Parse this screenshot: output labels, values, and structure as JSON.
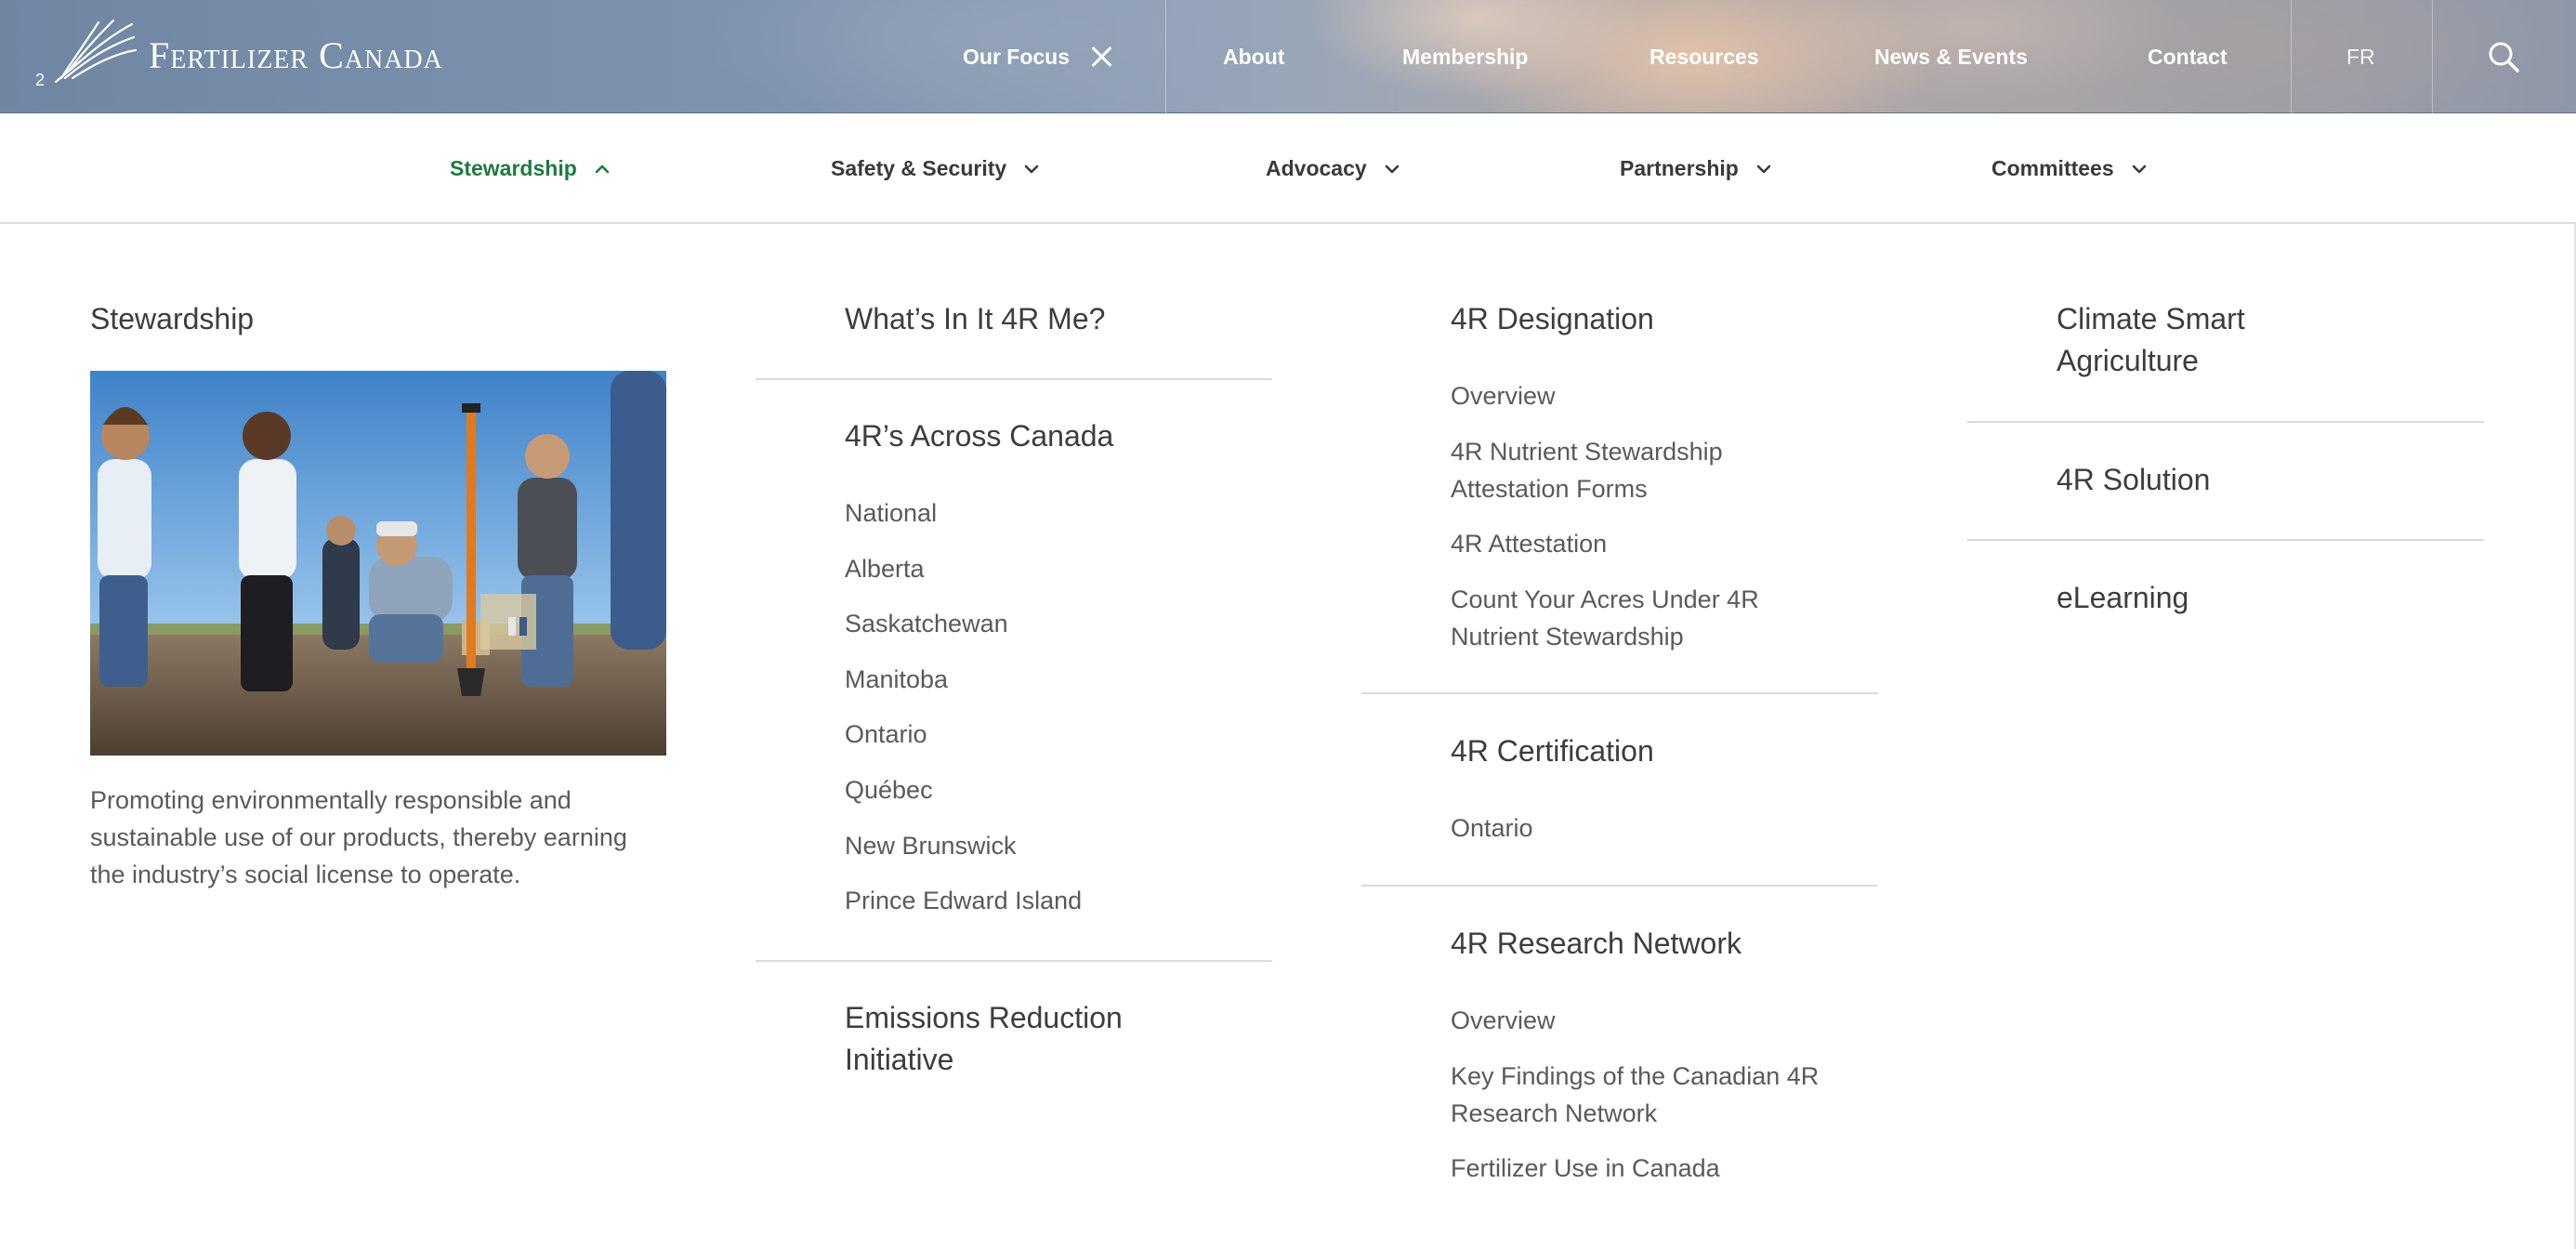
{
  "header": {
    "brand": "Fertilizer Canada",
    "nav": {
      "our_focus": "Our Focus",
      "about": "About",
      "membership": "Membership",
      "resources": "Resources",
      "news_events": "News & Events",
      "contact": "Contact",
      "language": "FR"
    }
  },
  "subnav": {
    "items": [
      {
        "label": "Stewardship",
        "active": true
      },
      {
        "label": "Safety & Security"
      },
      {
        "label": "Advocacy"
      },
      {
        "label": "Partnership"
      },
      {
        "label": "Committees"
      }
    ],
    "active_color": "#1f7a3f"
  },
  "mega": {
    "intro": {
      "title": "Stewardship",
      "description": "Promoting environmentally responsible and sustainable use of our products, thereby earning the industry’s social license to operate."
    },
    "col2": {
      "whats_in_it": "What’s In It 4R Me?",
      "across_canada": {
        "title": "4R’s Across Canada",
        "links": [
          "National",
          "Alberta",
          "Saskatchewan",
          "Manitoba",
          "Ontario",
          "Québec",
          "New Brunswick",
          "Prince Edward Island"
        ]
      },
      "emissions": "Emissions Reduction Initiative"
    },
    "col3": {
      "designation": {
        "title": "4R Designation",
        "links": [
          "Overview",
          "4R Nutrient Stewardship Attestation Forms",
          "4R Attestation",
          "Count Your Acres Under 4R Nutrient Stewardship"
        ]
      },
      "certification": {
        "title": "4R Certification",
        "links": [
          "Ontario"
        ]
      },
      "research": {
        "title": "4R Research Network",
        "links": [
          "Overview",
          "Key Findings of the Canadian 4R Research Network",
          "Fertilizer Use in Canada"
        ]
      }
    },
    "col4": {
      "climate": "Climate Smart Agriculture",
      "solution": "4R Solution",
      "elearning": "eLearning"
    }
  }
}
